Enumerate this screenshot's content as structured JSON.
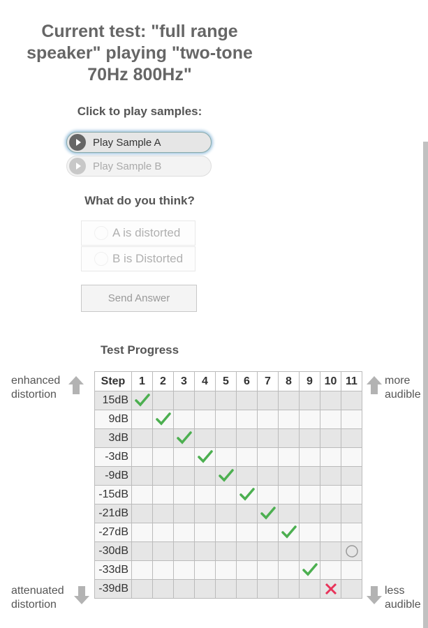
{
  "title": "Current test: \"full range speaker\" playing \"two-tone 70Hz 800Hz\"",
  "samples_label": "Click to play samples:",
  "play_a": "Play Sample A",
  "play_b": "Play Sample B",
  "question": "What do you think?",
  "option_a": "A is distorted",
  "option_b": "B is Distorted",
  "send": "Send Answer",
  "progress_label": "Test Progress",
  "side": {
    "enhanced": "enhanced distortion",
    "attenuated": "attenuated distortion",
    "more": "more audible",
    "less": "less audible"
  },
  "table": {
    "step_header": "Step",
    "steps": [
      "1",
      "2",
      "3",
      "4",
      "5",
      "6",
      "7",
      "8",
      "9",
      "10",
      "11"
    ],
    "levels": [
      "15dB",
      "9dB",
      "3dB",
      "-3dB",
      "-9dB",
      "-15dB",
      "-21dB",
      "-27dB",
      "-30dB",
      "-33dB",
      "-39dB"
    ],
    "marks": [
      {
        "level": "15dB",
        "step": 1,
        "result": "correct"
      },
      {
        "level": "9dB",
        "step": 2,
        "result": "correct"
      },
      {
        "level": "3dB",
        "step": 3,
        "result": "correct"
      },
      {
        "level": "-3dB",
        "step": 4,
        "result": "correct"
      },
      {
        "level": "-9dB",
        "step": 5,
        "result": "correct"
      },
      {
        "level": "-15dB",
        "step": 6,
        "result": "correct"
      },
      {
        "level": "-21dB",
        "step": 7,
        "result": "correct"
      },
      {
        "level": "-27dB",
        "step": 8,
        "result": "correct"
      },
      {
        "level": "-33dB",
        "step": 9,
        "result": "correct"
      },
      {
        "level": "-39dB",
        "step": 10,
        "result": "wrong"
      },
      {
        "level": "-30dB",
        "step": 11,
        "result": "current"
      }
    ]
  },
  "colors": {
    "correct": "#4caf50",
    "wrong": "#e8335a",
    "current": "#999999"
  },
  "icons": {
    "play": "play-icon",
    "up": "arrow-up-icon",
    "down": "arrow-down-icon"
  }
}
